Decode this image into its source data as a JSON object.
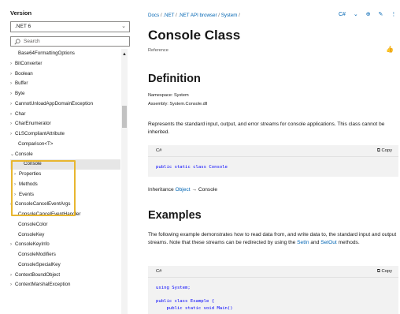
{
  "sidebar": {
    "version_label": "Version",
    "version_value": ".NET 6",
    "search_placeholder": "Search",
    "toc": [
      {
        "label": "Base64FormattingOptions",
        "arrow": false
      },
      {
        "label": "BitConverter",
        "arrow": true
      },
      {
        "label": "Boolean",
        "arrow": true
      },
      {
        "label": "Buffer",
        "arrow": true
      },
      {
        "label": "Byte",
        "arrow": true
      },
      {
        "label": "CannotUnloadAppDomainException",
        "arrow": true
      },
      {
        "label": "Char",
        "arrow": true
      },
      {
        "label": "CharEnumerator",
        "arrow": true
      },
      {
        "label": "CLSCompliantAttribute",
        "arrow": true
      },
      {
        "label": "Comparison<T>",
        "arrow": false
      },
      {
        "label": "Console",
        "arrow": true
      },
      {
        "label": "Console",
        "arrow": false
      },
      {
        "label": "Properties",
        "arrow": true
      },
      {
        "label": "Methods",
        "arrow": true
      },
      {
        "label": "Events",
        "arrow": true
      },
      {
        "label": "ConsoleCancelEventArgs",
        "arrow": true
      },
      {
        "label": "ConsoleCancelEventHandler",
        "arrow": false
      },
      {
        "label": "ConsoleColor",
        "arrow": false
      },
      {
        "label": "ConsoleKey",
        "arrow": false
      },
      {
        "label": "ConsoleKeyInfo",
        "arrow": true
      },
      {
        "label": "ConsoleModifiers",
        "arrow": false
      },
      {
        "label": "ConsoleSpecialKey",
        "arrow": false
      },
      {
        "label": "ContextBoundObject",
        "arrow": true
      },
      {
        "label": "ContextMarshalException",
        "arrow": true
      }
    ]
  },
  "main": {
    "breadcrumbs": [
      "Docs",
      ".NET",
      ".NET API browser",
      "System"
    ],
    "lang_selector": "C#",
    "page_title": "Console Class",
    "reference_label": "Reference",
    "definition_heading": "Definition",
    "namespace_line": "Namespace: System",
    "assembly_line": "Assembly: System.Console.dll",
    "description": "Represents the standard input, output, and error streams for console applications. This class cannot be inherited.",
    "code1": {
      "lang": "C#",
      "copy": "Copy",
      "code": "public static class Console"
    },
    "inheritance_label": "Inheritance",
    "inheritance_object": "Object",
    "inheritance_arrow": "→",
    "inheritance_console": "Console",
    "examples_heading": "Examples",
    "examples_text_1": "The following example demonstrates how to read data from, and write data to, the standard input and output streams. Note that these streams can be redirected by using the ",
    "setin_link": "SetIn",
    "examples_and": " and ",
    "setout_link": "SetOut",
    "examples_text_2": " methods.",
    "code2": {
      "lang": "C#",
      "copy": "Copy",
      "line1": "using System;",
      "line2": "public class Example {",
      "line3": "    public static void Main()"
    }
  },
  "colors": {
    "accent": "#0065b3",
    "highlight": "#e8b62f",
    "keyword": "#0101fd"
  }
}
